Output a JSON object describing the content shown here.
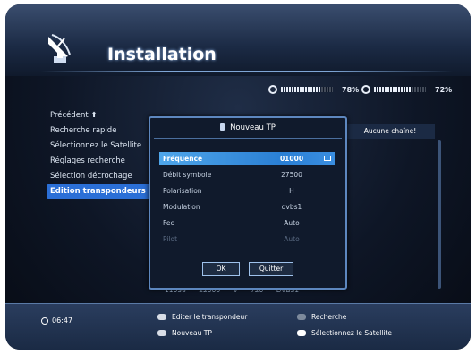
{
  "header": {
    "title": "Installation"
  },
  "signal": {
    "strength": {
      "label": "78%",
      "value": 0.78
    },
    "quality": {
      "label": "72%",
      "value": 0.72
    }
  },
  "menu": {
    "items": [
      {
        "label": "Précédent  ⬆"
      },
      {
        "label": "Recherche rapide"
      },
      {
        "label": "Sélectionnez le Satellite"
      },
      {
        "label": "Réglages recherche"
      },
      {
        "label": "Sélection décrochage"
      },
      {
        "label": "Edition transpondeurs"
      }
    ]
  },
  "background": {
    "column_header": "Aucune chaîne!",
    "row": "11038  22000   V   720   DVBS1"
  },
  "dialog": {
    "title": "Nouveau TP",
    "fields": [
      {
        "label": "Fréquence",
        "value": "01000"
      },
      {
        "label": "Débit symbole",
        "value": "27500"
      },
      {
        "label": "Polarisation",
        "value": "H"
      },
      {
        "label": "Modulation",
        "value": "dvbs1"
      },
      {
        "label": "Fec",
        "value": "Auto"
      },
      {
        "label": "Pilot",
        "value": "Auto"
      }
    ],
    "ok_label": "OK",
    "quit_label": "Quitter"
  },
  "footer": {
    "time": "06:47",
    "hints": {
      "red": "Editer le transpondeur",
      "green": "Recherche",
      "yellow": "Nouveau TP",
      "blue": "Sélectionnez le Satellite"
    }
  },
  "colors": {
    "highlight": "#2b6fd6",
    "field_selected": "#3a8ee0",
    "dialog_border": "#5d87bf"
  }
}
